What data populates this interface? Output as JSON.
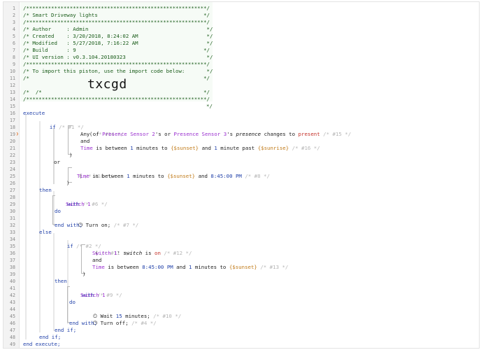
{
  "gutter": {
    "line_numbers": [
      "1",
      "2",
      "3",
      "4",
      "5",
      "6",
      "7",
      "8",
      "9",
      "10",
      "11",
      "12",
      "13",
      "14",
      "15",
      "16",
      "17",
      "18",
      "19",
      "20",
      "21",
      "22",
      "23",
      "24",
      "25",
      "26",
      "27",
      "28",
      "29",
      "30",
      "31",
      "32",
      "33",
      "34",
      "35",
      "36",
      "37",
      "38",
      "39",
      "40",
      "41",
      "42",
      "43",
      "44",
      "45",
      "46",
      "47",
      "48",
      "49"
    ],
    "marker_line": "19"
  },
  "header": {
    "border": "/**********************************************************/",
    "title": "/* Smart Driveway lights                                  */",
    "author": "/* Author     : Admin                                      */",
    "created": "/* Created    : 3/20/2018, 8:24:02 AM                      */",
    "modified": "/* Modified   : 5/27/2018, 7:16:22 AM                      */",
    "build": "/* Build      : 9                                         */",
    "ui_version": "/* UI version : v0.3.104.20180323                          */",
    "import_note": "/* To import this piston, use the import code below:       */",
    "blank": "/*                                                        */",
    "code_prefix": "/*",
    "import_code": "txcgd",
    "code_suffix": "*/"
  },
  "code": {
    "execute": "execute",
    "if": "if",
    "or": "or",
    "and": "and",
    "then": "then",
    "else": "else",
    "with": "with",
    "do": "do",
    "end_with": "end with;",
    "end_if": "end if;",
    "end_execute": "end execute;",
    "open_paren": "(",
    "close_paren": ")",
    "c1": "/* #1 */",
    "c14": "/* #14 */",
    "c15": "/* #15 */",
    "c16": "/* #16 */",
    "c18": "/* #18 */",
    "c8": "/* #8 */",
    "c6": "/* #6 */",
    "c7": "/* #7 */",
    "c2": "/* #2 */",
    "c11": "/* #11 */",
    "c12": "/* #12 */",
    "c13": "/* #13 */",
    "c9": "/* #9 */",
    "c10": "/* #10 */",
    "c4": "/* #4 */",
    "l19": {
      "t1": "Any of ",
      "dev1": "Presence Sensor 2",
      "t2": "'s or ",
      "dev2": "Presence Sensor 3",
      "t3": "'s ",
      "attr": "presence",
      "t4": " changes to ",
      "val": "present"
    },
    "l21": {
      "attr": "Time",
      "t1": " is between ",
      "n1": "1",
      "t2": " minutes to ",
      "v1": "{$sunset}",
      "t3": " and ",
      "n2": "1",
      "t4": " minute past ",
      "v2": "{$sunrise}"
    },
    "l25": {
      "attr": "Time",
      "t1": " is between ",
      "n1": "1",
      "t2": " minutes to ",
      "v1": "{$sunset}",
      "t3": " and ",
      "n2": "8:45:00 PM"
    },
    "switch1": "Switch 1",
    "turn_on": "Turn on;",
    "l36": {
      "dev": "Switch 1",
      "t1": "' ",
      "attr": "switch",
      "t2": " is ",
      "val": "on"
    },
    "l38": {
      "attr": "Time",
      "t1": " is between ",
      "n1": "8:45:00 PM",
      "t2": " and ",
      "n2": "1",
      "t3": " minutes to ",
      "v1": "{$sunset}"
    },
    "wait": {
      "t1": "Wait ",
      "n": "15",
      "t2": " minutes;"
    },
    "turn_off": "Turn off;"
  }
}
